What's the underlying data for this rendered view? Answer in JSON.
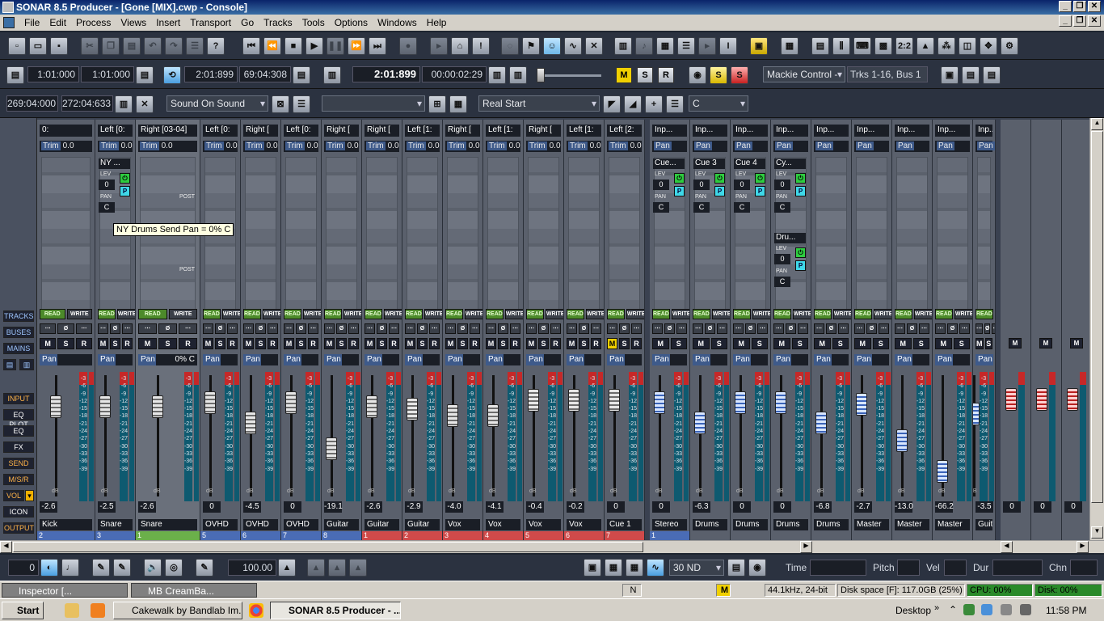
{
  "window": {
    "title": "SONAR 8.5 Producer - [Gone [MIX].cwp - Console]"
  },
  "menu": [
    "File",
    "Edit",
    "Process",
    "Views",
    "Insert",
    "Transport",
    "Go",
    "Tracks",
    "Tools",
    "Options",
    "Windows",
    "Help"
  ],
  "transport": {
    "loop_start": "1:01:000",
    "loop_end": "1:01:000",
    "punch_time": "2:01:899",
    "time2": "69:04:308",
    "now": "2:01:899",
    "timecode": "00:00:02:29",
    "m_label": "M",
    "s_label": "S",
    "r_label": "R",
    "control_surface": "Mackie Control - ",
    "tracks_buses": "Trks 1-16, Bus 1"
  },
  "row3": {
    "sel_start": "269:04:000",
    "sel_end": "272:04:633",
    "snap_combo": "Sound On Sound",
    "empty_combo": "",
    "start_combo": "Real Start",
    "key_combo": "C"
  },
  "left_buttons": [
    "TRACKS",
    "BUSES",
    "MAINS",
    "INPUT",
    "EQ PLOT",
    "EQ",
    "FX",
    "SEND",
    "M/S/R",
    "VOL",
    "ICON",
    "OUTPUT"
  ],
  "strips": [
    {
      "name": "0:",
      "trim": "0.0",
      "vol": "-2.6",
      "track": "Kick",
      "num": "2"
    },
    {
      "name": "Left [0:",
      "trim": "0.0",
      "vol": "-2.5",
      "track": "Snare",
      "num": "3"
    },
    {
      "name": "Right [03-04]",
      "trim": "0.0",
      "vol": "-2.6",
      "track": "Snare",
      "num": "1"
    },
    {
      "name": "Left [0:",
      "trim": "0.0",
      "vol": "0",
      "track": "OVHD",
      "num": "5"
    },
    {
      "name": "Right [",
      "trim": "0.0",
      "vol": "-4.5",
      "track": "OVHD",
      "num": "6"
    },
    {
      "name": "Left [0:",
      "trim": "0.0",
      "vol": "0",
      "track": "OVHD",
      "num": "7"
    },
    {
      "name": "Right [",
      "trim": "0.0",
      "vol": "-19.1",
      "track": "Guitar",
      "num": "8"
    },
    {
      "name": "Right [",
      "trim": "0.0",
      "vol": "-2.6",
      "track": "Guitar",
      "num": "1"
    },
    {
      "name": "Left [1:",
      "trim": "0.0",
      "vol": "-2.9",
      "track": "Guitar",
      "num": "2"
    },
    {
      "name": "Right [",
      "trim": "0.0",
      "vol": "-4.0",
      "track": "Vox",
      "num": "3"
    },
    {
      "name": "Left [1:",
      "trim": "0.0",
      "vol": "-4.1",
      "track": "Vox",
      "num": "4"
    },
    {
      "name": "Right [",
      "trim": "0.0",
      "vol": "-0.4",
      "track": "Vox",
      "num": "5"
    },
    {
      "name": "Left [1:",
      "trim": "0.0",
      "vol": "-0.2",
      "track": "Vox",
      "num": "6"
    },
    {
      "name": "Left [2:",
      "trim": "0.0",
      "vol": "0",
      "track": "Cue 1",
      "num": "7"
    }
  ],
  "buses": [
    {
      "name": "Inp...",
      "sub": "0",
      "vol": "0",
      "track": "Stereo",
      "num": "1"
    },
    {
      "name": "Inp...",
      "sub": "0",
      "vol": "-6.3",
      "track": "Drums",
      "num": ""
    },
    {
      "name": "Inp...",
      "sub": "0",
      "vol": "0",
      "track": "Drums",
      "num": ""
    },
    {
      "name": "Inp...",
      "sub": "0",
      "vol": "0",
      "track": "Drums",
      "num": ""
    },
    {
      "name": "Inp...",
      "sub": "0",
      "vol": "-6.8",
      "track": "Drums",
      "num": ""
    },
    {
      "name": "Inp...",
      "sub": "0",
      "vol": "-2.7",
      "track": "Master",
      "num": ""
    },
    {
      "name": "Inp...",
      "sub": "0",
      "vol": "-13.0",
      "track": "Master",
      "num": ""
    },
    {
      "name": "Inp...",
      "sub": "0",
      "vol": "-66.2",
      "track": "Master",
      "num": ""
    },
    {
      "name": "Inp...",
      "sub": "0",
      "vol": "-3.5",
      "track": "Guita",
      "num": ""
    }
  ],
  "mains": [
    {
      "vol": "0"
    },
    {
      "vol": "0"
    },
    {
      "vol": "0"
    }
  ],
  "sends": {
    "ny": "NY ...",
    "cue": "Cue...",
    "cue3": "Cue 3",
    "cue4": "Cue 4",
    "cy": "Cy...",
    "dru": "Dru...",
    "lev": "LEV",
    "pan": "PAN",
    "zero": "0",
    "c": "C",
    "post": "POST"
  },
  "tooltip": "NY Drums Send Pan = 0% C",
  "snare_pan": "0% C",
  "pan_label": "Pan",
  "trim_label": "Trim",
  "read_label": "READ",
  "write_label": "WRITE",
  "db_scale": [
    "-3",
    "-6",
    "-9",
    "-12",
    "-15",
    "-18",
    "-21",
    "-24",
    "-27",
    "-30",
    "-33",
    "-36",
    "-39"
  ],
  "bottom": {
    "tempo_val": "0",
    "velocity": "100.00",
    "snap": "30 ND",
    "time_label": "Time",
    "pitch_label": "Pitch",
    "vel_label": "Vel",
    "dur_label": "Dur",
    "chn_label": "Chn"
  },
  "mdi": {
    "inspector": "Inspector [...",
    "mb": "MB CreamBa...",
    "n": "N",
    "m": "M",
    "rate": "44.1kHz, 24-bit",
    "disk": "Disk space [F]: 117.0GB (25%)",
    "cpu": "CPU: 00%",
    "diskpct": "Disk: 00%"
  },
  "taskbar": {
    "start": "Start",
    "task1": "Cakewalk by Bandlab Im...",
    "task2": "SONAR 8.5 Producer - ...",
    "desktop": "Desktop",
    "clock": "11:58 PM"
  },
  "colors": {
    "accent": "#f0d000",
    "meter_red": "#c62828",
    "meter_blue": "#0e5a70",
    "read_green": "#4c8a2a"
  }
}
